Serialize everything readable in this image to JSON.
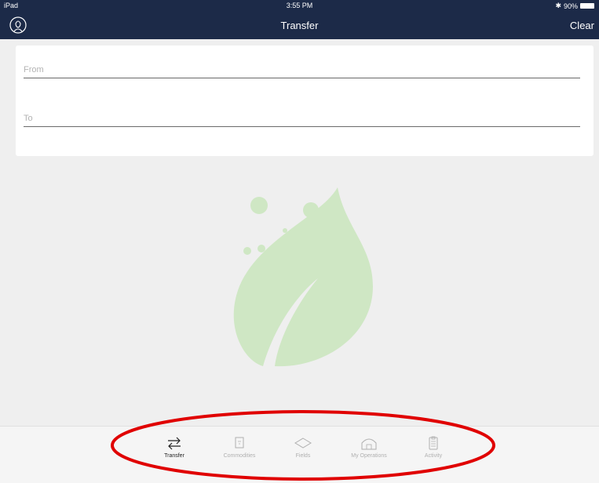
{
  "status_bar": {
    "device": "iPad",
    "time": "3:55 PM",
    "battery": "90%"
  },
  "nav": {
    "title": "Transfer",
    "right_action": "Clear",
    "left_icon": "profile-icon"
  },
  "form": {
    "from_placeholder": "From",
    "to_placeholder": "To",
    "from_value": "",
    "to_value": ""
  },
  "tabs": [
    {
      "label": "Transfer",
      "icon": "transfer-icon",
      "active": true
    },
    {
      "label": "Commodities",
      "icon": "commodities-icon",
      "active": false
    },
    {
      "label": "Fields",
      "icon": "fields-icon",
      "active": false
    },
    {
      "label": "My Operations",
      "icon": "barn-icon",
      "active": false
    },
    {
      "label": "Activity",
      "icon": "clipboard-icon",
      "active": false
    }
  ],
  "colors": {
    "nav_bg": "#1c2a48",
    "leaf": "#cfe7c4",
    "annotation": "#e00000"
  }
}
